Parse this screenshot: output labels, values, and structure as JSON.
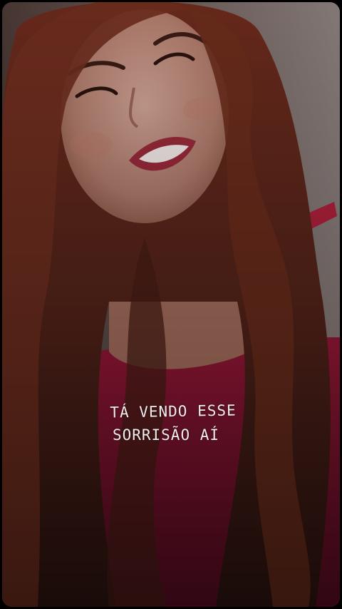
{
  "story": {
    "caption": {
      "line1": "TÁ VENDO ESSE",
      "line2": "SORRISÃO AÍ"
    }
  },
  "colors": {
    "background": "#000000",
    "hair": "#7a3a24",
    "skin": "#c99a8c",
    "dress": "#8a1432",
    "caption_text": "#f2ecec"
  }
}
